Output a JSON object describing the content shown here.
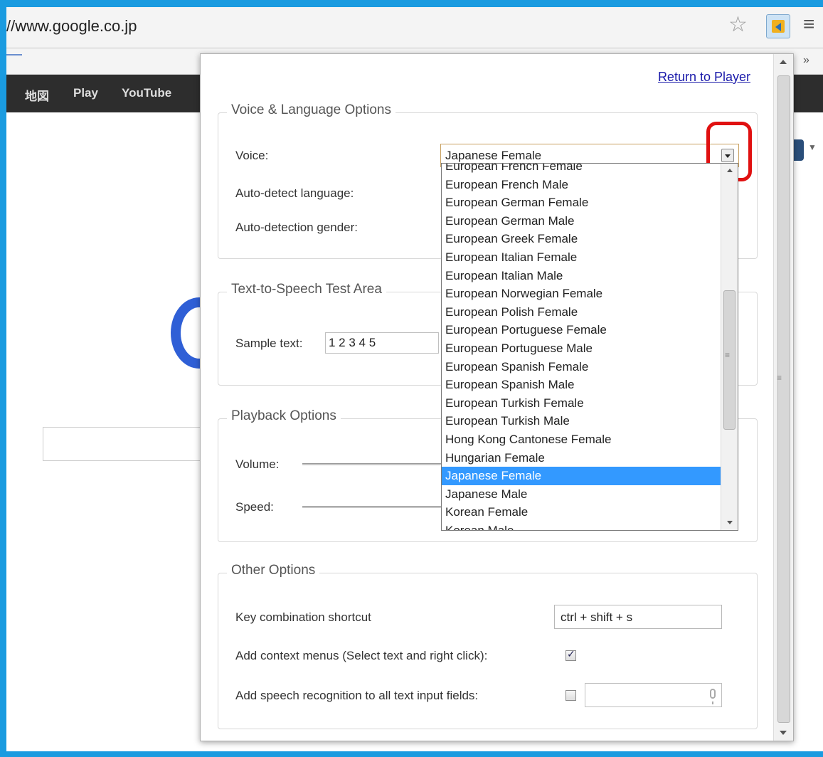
{
  "browser": {
    "url": "//www.google.co.jp",
    "google_bar": [
      "地図",
      "Play",
      "YouTube"
    ]
  },
  "popup": {
    "return_link": "Return to Player",
    "voice_section": {
      "legend": "Voice & Language Options",
      "voice_label": "Voice:",
      "voice_value": "Japanese Female",
      "autodetect_label": "Auto-detect language:",
      "gender_label": "Auto-detection gender:"
    },
    "tts_section": {
      "legend": "Text-to-Speech Test Area",
      "sample_label": "Sample text:",
      "sample_value": "1 2 3 4 5"
    },
    "playback_section": {
      "legend": "Playback Options",
      "volume_label": "Volume:",
      "speed_label": "Speed:"
    },
    "other_section": {
      "legend": "Other Options",
      "shortcut_label": "Key combination shortcut",
      "shortcut_value": "ctrl + shift + s",
      "context_menu_label": "Add context menus (Select text and right click):",
      "context_menu_checked": true,
      "speech_recognition_label": "Add speech recognition to all text input fields:",
      "speech_recognition_checked": false
    }
  },
  "dropdown": {
    "selected": "Japanese Female",
    "items": [
      "European French Female",
      "European French Male",
      "European German Female",
      "European German Male",
      "European Greek Female",
      "European Italian Female",
      "European Italian Male",
      "European Norwegian Female",
      "European Polish Female",
      "European Portuguese Female",
      "European Portuguese Male",
      "European Spanish Female",
      "European Spanish Male",
      "European Turkish Female",
      "European Turkish Male",
      "Hong Kong Cantonese Female",
      "Hungarian Female",
      "Japanese Female",
      "Japanese Male",
      "Korean Female",
      "Korean Male"
    ]
  },
  "colors": {
    "frame": "#1a9be0",
    "selection": "#3399ff",
    "highlight": "#e01010",
    "link": "#1a1aaa"
  }
}
